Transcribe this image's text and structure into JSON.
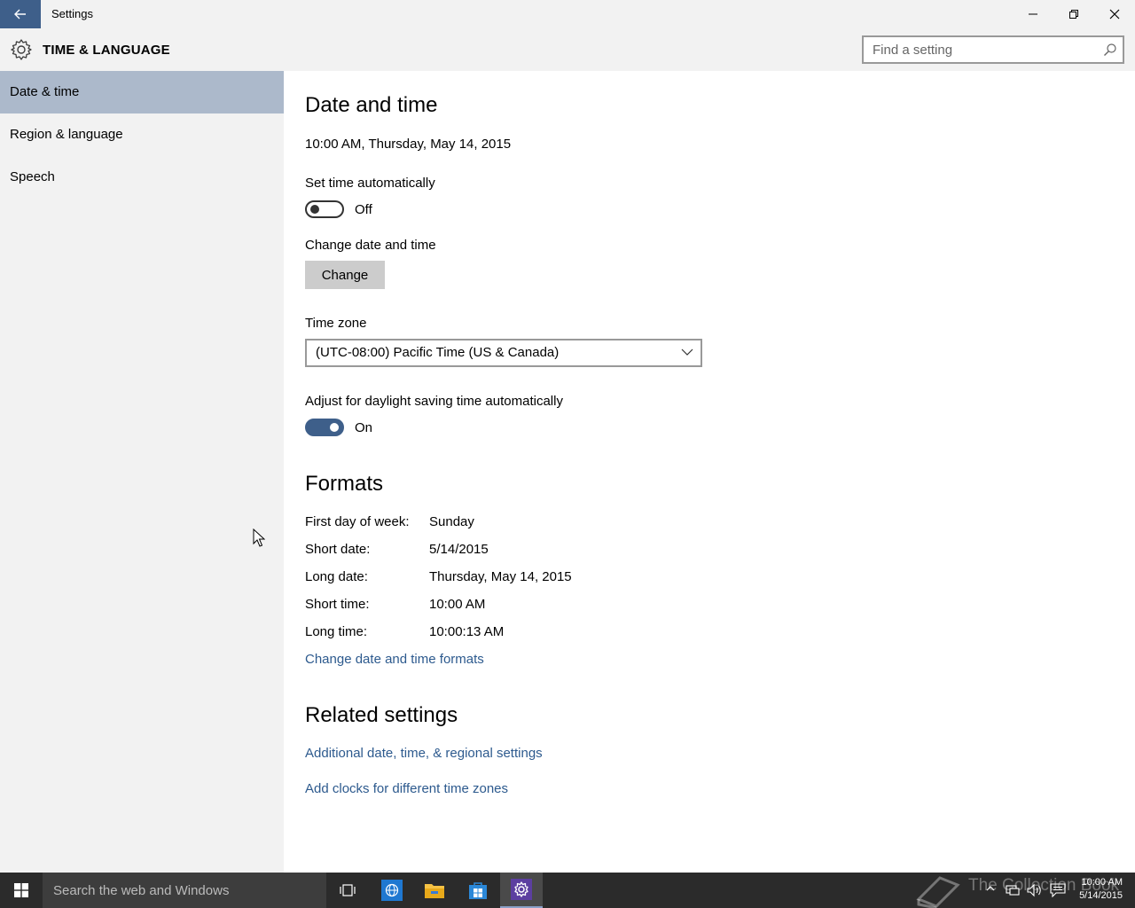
{
  "window": {
    "title": "Settings"
  },
  "header": {
    "app_title": "TIME & LANGUAGE",
    "search_placeholder": "Find a setting"
  },
  "sidebar": {
    "items": [
      {
        "label": "Date & time",
        "selected": true
      },
      {
        "label": "Region & language",
        "selected": false
      },
      {
        "label": "Speech",
        "selected": false
      }
    ]
  },
  "main": {
    "title": "Date and time",
    "current_datetime": "10:00 AM, Thursday, May 14, 2015",
    "set_time_auto": {
      "label": "Set time automatically",
      "state": "Off"
    },
    "change_datetime": {
      "label": "Change date and time",
      "button": "Change"
    },
    "time_zone": {
      "label": "Time zone",
      "value": "(UTC-08:00) Pacific Time (US & Canada)"
    },
    "daylight": {
      "label": "Adjust for daylight saving time automatically",
      "state": "On"
    },
    "formats": {
      "title": "Formats",
      "rows": [
        {
          "label": "First day of week:",
          "value": "Sunday"
        },
        {
          "label": "Short date:",
          "value": "5/14/2015"
        },
        {
          "label": "Long date:",
          "value": "Thursday, May 14, 2015"
        },
        {
          "label": "Short time:",
          "value": "10:00 AM"
        },
        {
          "label": "Long time:",
          "value": "10:00:13 AM"
        }
      ],
      "change_link": "Change date and time formats"
    },
    "related": {
      "title": "Related settings",
      "links": [
        "Additional date, time, & regional settings",
        "Add clocks for different time zones"
      ]
    }
  },
  "taskbar": {
    "search_placeholder": "Search the web and Windows",
    "clock_time": "10:00 AM",
    "clock_date": "5/14/2015",
    "watermark": "The Collection Book"
  },
  "colors": {
    "accent": "#3e5f8a",
    "selected_nav": "#acb9cb",
    "link": "#2d5a8e",
    "taskbar": "#2b2b2b"
  }
}
